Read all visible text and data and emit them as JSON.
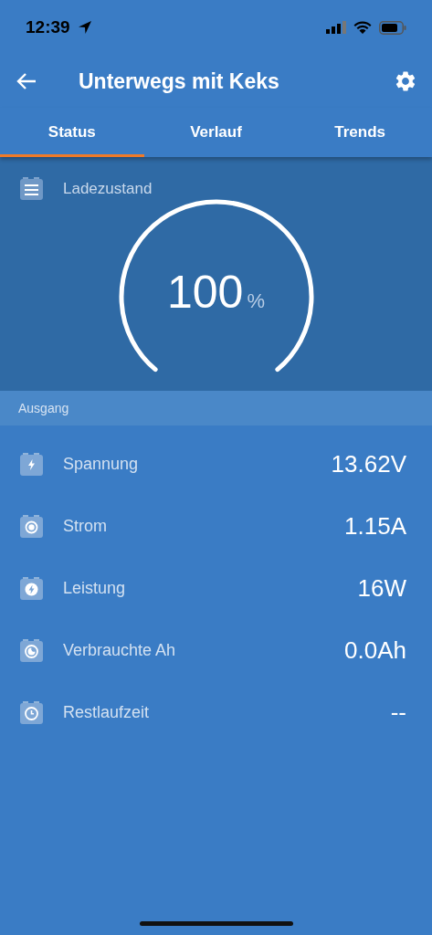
{
  "status_bar": {
    "time": "12:39"
  },
  "header": {
    "title": "Unterwegs mit Keks"
  },
  "tabs": [
    {
      "label": "Status",
      "selected": true
    },
    {
      "label": "Verlauf",
      "selected": false
    },
    {
      "label": "Trends",
      "selected": false
    }
  ],
  "charge": {
    "label": "Ladezustand",
    "value": "100",
    "unit": "%"
  },
  "section": {
    "title": "Ausgang"
  },
  "rows": [
    {
      "kind": "voltage",
      "label": "Spannung",
      "value": "13.62V"
    },
    {
      "kind": "current",
      "label": "Strom",
      "value": "1.15A"
    },
    {
      "kind": "power",
      "label": "Leistung",
      "value": "16W"
    },
    {
      "kind": "consumed",
      "label": "Verbrauchte Ah",
      "value": "0.0Ah"
    },
    {
      "kind": "time",
      "label": "Restlaufzeit",
      "value": "--"
    }
  ]
}
